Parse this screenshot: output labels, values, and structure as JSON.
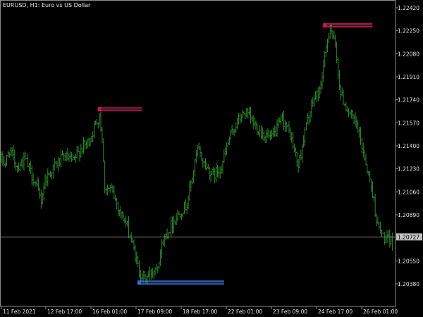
{
  "window": {
    "title": "EURUSD, H1:  Euro vs US Dollar"
  },
  "colors": {
    "background": "#000000",
    "candles": "#2e8b2e",
    "frame": "#8c8c8c",
    "text": "#e6e6e6",
    "bid_line": "#808080",
    "high_level": "#d4145a",
    "low_level": "#2e6fe0"
  },
  "chart_data": {
    "type": "line",
    "price_axis": [
      "1.22420",
      "1.22250",
      "1.22080",
      "1.21910",
      "1.21740",
      "1.21570",
      "1.21400",
      "1.21230",
      "1.21060",
      "1.20890",
      "1.20550",
      "1.20380"
    ],
    "price_axis_values": [
      1.2242,
      1.2225,
      1.2208,
      1.2191,
      1.2174,
      1.2157,
      1.214,
      1.2123,
      1.2106,
      1.2089,
      1.2055,
      1.2038
    ],
    "current_price": "1.20727",
    "current_price_value": 1.20727,
    "time_axis": [
      "11 Feb 2021",
      "12 Feb 17:00",
      "16 Feb 01:00",
      "17 Feb 09:00",
      "18 Feb 17:00",
      "22 Feb 01:00",
      "23 Feb 09:00",
      "24 Feb 17:00",
      "26 Feb 01:00"
    ],
    "levels": [
      {
        "kind": "high",
        "price": 1.2167,
        "from_bar": 74,
        "to_bar": 106
      },
      {
        "kind": "low",
        "price": 1.2039,
        "from_bar": 104,
        "to_bar": 168
      },
      {
        "kind": "high",
        "price": 1.2229,
        "from_bar": 244,
        "to_bar": 280
      }
    ],
    "anchors": [
      [
        0,
        1.213
      ],
      [
        3,
        1.2127
      ],
      [
        6,
        1.2137
      ],
      [
        12,
        1.2125
      ],
      [
        18,
        1.213
      ],
      [
        24,
        1.2116
      ],
      [
        30,
        1.21
      ],
      [
        33,
        1.2115
      ],
      [
        40,
        1.2125
      ],
      [
        48,
        1.2132
      ],
      [
        54,
        1.2128
      ],
      [
        60,
        1.2138
      ],
      [
        66,
        1.2143
      ],
      [
        72,
        1.2158
      ],
      [
        74,
        1.2163
      ],
      [
        76,
        1.2145
      ],
      [
        78,
        1.211
      ],
      [
        83,
        1.2107
      ],
      [
        88,
        1.2095
      ],
      [
        95,
        1.208
      ],
      [
        100,
        1.2063
      ],
      [
        104,
        1.2047
      ],
      [
        108,
        1.2042
      ],
      [
        112,
        1.2045
      ],
      [
        118,
        1.2053
      ],
      [
        122,
        1.207
      ],
      [
        130,
        1.2085
      ],
      [
        140,
        1.2097
      ],
      [
        148,
        1.2137
      ],
      [
        154,
        1.2125
      ],
      [
        160,
        1.2118
      ],
      [
        166,
        1.2125
      ],
      [
        172,
        1.2145
      ],
      [
        178,
        1.2158
      ],
      [
        184,
        1.2165
      ],
      [
        190,
        1.2157
      ],
      [
        196,
        1.215
      ],
      [
        204,
        1.2145
      ],
      [
        212,
        1.216
      ],
      [
        218,
        1.2148
      ],
      [
        224,
        1.2125
      ],
      [
        230,
        1.2155
      ],
      [
        236,
        1.2175
      ],
      [
        240,
        1.218
      ],
      [
        244,
        1.2205
      ],
      [
        248,
        1.223
      ],
      [
        252,
        1.2212
      ],
      [
        256,
        1.2178
      ],
      [
        262,
        1.2165
      ],
      [
        268,
        1.2155
      ],
      [
        274,
        1.2132
      ],
      [
        280,
        1.2105
      ],
      [
        284,
        1.208
      ],
      [
        290,
        1.207
      ]
    ]
  }
}
